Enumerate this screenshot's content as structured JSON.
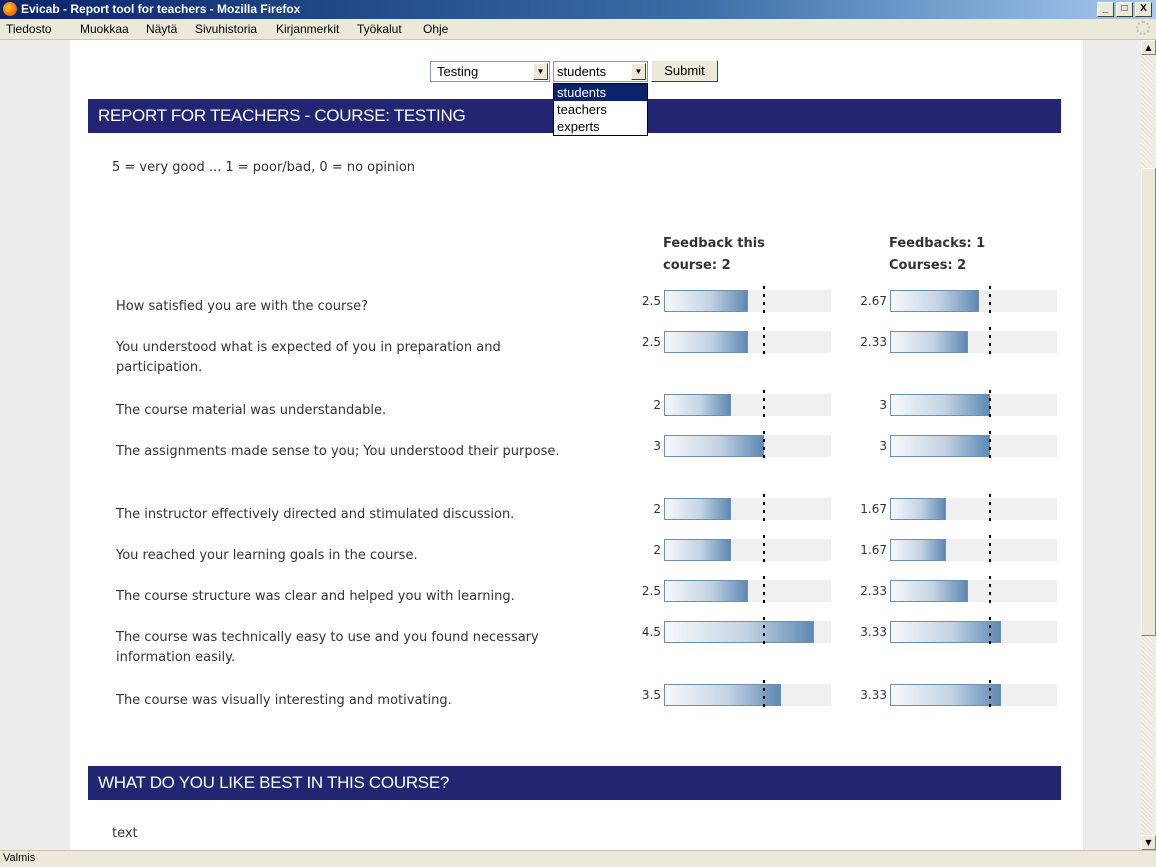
{
  "window": {
    "title": "Evicab - Report tool for teachers - Mozilla Firefox",
    "min": "_",
    "max": "□",
    "close": "X"
  },
  "menu": [
    "Tiedosto",
    "Muokkaa",
    "Näytä",
    "Sivuhistoria",
    "Kirjanmerkit",
    "Työkalut",
    "Ohje"
  ],
  "form": {
    "course_select": "Testing",
    "audience_select": "students",
    "audience_options": [
      "students",
      "teachers",
      "experts"
    ],
    "submit_label": "Submit"
  },
  "report": {
    "title": "REPORT FOR TEACHERS - COURSE: TESTING",
    "scale_note": "5 = very good ... 1 = poor/bad, 0 = no opinion",
    "col1_header_line1": "Feedback this",
    "col1_header_line2": "course: 2",
    "col2_header_line1": "Feedbacks: 1",
    "col2_header_line2": "Courses: 2",
    "scale_max": 5,
    "reference_mark": 3,
    "questions": [
      {
        "text": "How satisfied you are with the course?",
        "course": 2.5,
        "course_label": "2.5",
        "all": 2.67,
        "all_label": "2.67"
      },
      {
        "text": "You understood what is expected of you in preparation and participation.",
        "course": 2.5,
        "course_label": "2.5",
        "all": 2.33,
        "all_label": "2.33"
      },
      {
        "text": "The course material was understandable.",
        "course": 2,
        "course_label": "2",
        "all": 3,
        "all_label": "3"
      },
      {
        "text": "The assignments made sense to you; You understood their purpose.",
        "course": 3,
        "course_label": "3",
        "all": 3,
        "all_label": "3"
      },
      {
        "text": "The instructor effectively directed and stimulated discussion.",
        "course": 2,
        "course_label": "2",
        "all": 1.67,
        "all_label": "1.67"
      },
      {
        "text": "You reached your learning goals in the course.",
        "course": 2,
        "course_label": "2",
        "all": 1.67,
        "all_label": "1.67"
      },
      {
        "text": "The course structure was clear and helped you with learning.",
        "course": 2.5,
        "course_label": "2.5",
        "all": 2.33,
        "all_label": "2.33"
      },
      {
        "text": "The course was technically easy to use and you found necessary information easily.",
        "course": 4.5,
        "course_label": "4.5",
        "all": 3.33,
        "all_label": "3.33"
      },
      {
        "text": "The course was visually interesting and motivating.",
        "course": 3.5,
        "course_label": "3.5",
        "all": 3.33,
        "all_label": "3.33"
      }
    ]
  },
  "section2": {
    "title": "WHAT DO YOU LIKE BEST IN THIS COURSE?",
    "text": "text"
  },
  "status": "Valmis"
}
